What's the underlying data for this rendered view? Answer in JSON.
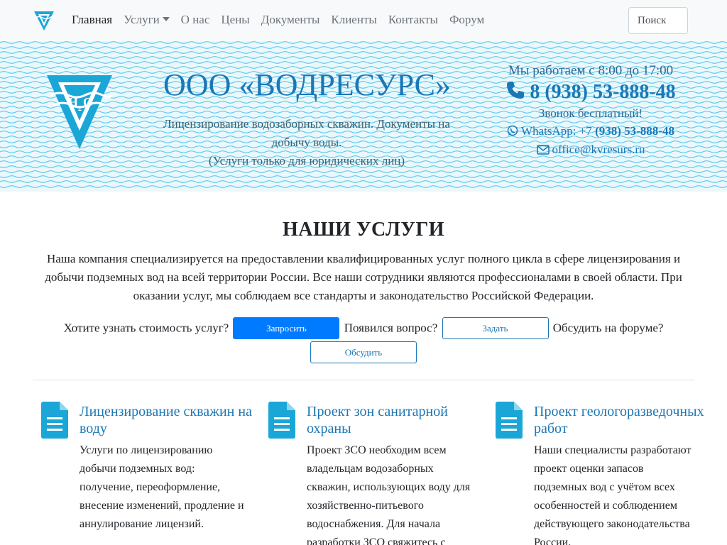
{
  "navbar": {
    "links": [
      {
        "label": "Главная",
        "active": true
      },
      {
        "label": "Услуги",
        "dropdown": true
      },
      {
        "label": "О нас"
      },
      {
        "label": "Цены"
      },
      {
        "label": "Документы"
      },
      {
        "label": "Клиенты"
      },
      {
        "label": "Контакты"
      },
      {
        "label": "Форум"
      }
    ],
    "search_placeholder": "Поиск"
  },
  "header": {
    "company_name": "ООО «ВОДРЕСУРС»",
    "tagline_line1": "Лицензирование водозаборных скважин. Документы на добычу воды.",
    "tagline_line2": "(Услуги только для юридических лиц)",
    "hours": "Мы работаем с 8:00 до 17:00",
    "phone": "8 (938) 53-888-48",
    "free_call": "Звонок бесплатный!",
    "whatsapp_label": "WhatsApp: +7",
    "whatsapp_number": "(938) 53-888-48",
    "email": "office@kvresurs.ru"
  },
  "services": {
    "title": "НАШИ УСЛУГИ",
    "intro": "Наша компания специализируется на предоставлении квалифицированных услуг полного цикла в сфере лицензирования и добычи подземных вод на всей территории России. Все наши сотрудники являются профессионалами в своей области. При оказании услуг, мы соблюдаем все стандарты и законодательство Российской Федерации.",
    "cta": {
      "q1": "Хотите узнать стоимость услуг?",
      "b1": "Запросить",
      "q2": "Появился вопрос?",
      "b2": "Задать",
      "q3": "Обсудить на форуме?",
      "b3": "Обсудить"
    },
    "cards": [
      {
        "title": "Лицензирование скважин на воду",
        "text": "Услуги по лицензированию добычи подземных вод: получение, переоформление, внесение изменений, продление и аннулирование лицензий."
      },
      {
        "title": "Проект зон санитарной охраны",
        "text": "Проект ЗСО необходим всем владельцам водозаборных скважин, использующих воду для хозяйственно-питьевого водоснабжения. Для начала разработки ЗСО свяжитесь с нами."
      },
      {
        "title": "Проект геологоразведочных работ",
        "text": "Наши специалисты разработают проект оценки запасов подземных вод с учётом всех особенностей и соблюдением действующего законодательства России."
      }
    ]
  },
  "colors": {
    "brand": "#1b77b6",
    "primary_button": "#007bff",
    "wave": "#29b6e6"
  }
}
